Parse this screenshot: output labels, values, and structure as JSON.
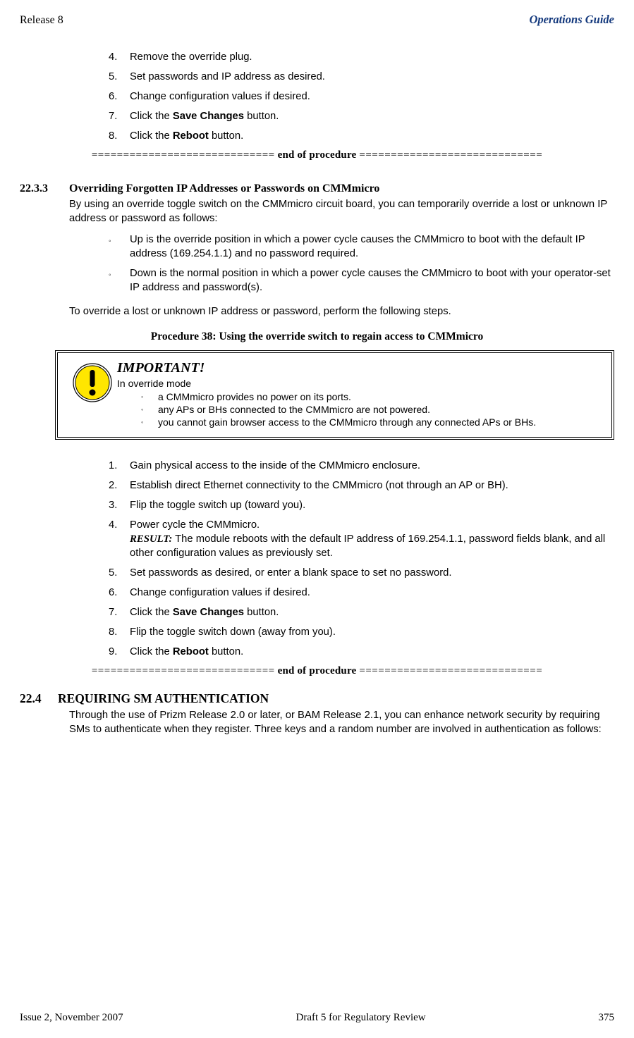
{
  "header": {
    "left": "Release 8",
    "right": "Operations Guide"
  },
  "proc1": {
    "items": [
      {
        "n": "4.",
        "pre": "Remove the override plug."
      },
      {
        "n": "5.",
        "pre": "Set passwords and IP address as desired."
      },
      {
        "n": "6.",
        "pre": "Change configuration values if desired."
      },
      {
        "n": "7.",
        "pre": "Click the ",
        "bold": "Save Changes",
        "post": " button."
      },
      {
        "n": "8.",
        "pre": "Click the ",
        "bold": "Reboot",
        "post": " button."
      }
    ]
  },
  "eop": {
    "sep": "=============================",
    "label": " end of procedure "
  },
  "section": {
    "num": "22.3.3",
    "title": "Overriding Forgotten IP Addresses or Passwords on CMMmicro",
    "intro": "By using an override toggle switch on the CMMmicro circuit board, you can temporarily override a lost or unknown IP address or password as follows:",
    "bullets": [
      "Up is the override position in which a power cycle causes the CMMmicro to boot with the default IP address (169.254.1.1) and no password required.",
      "Down is the normal position in which a power cycle causes the CMMmicro to boot with your operator-set IP address and password(s)."
    ],
    "lead": "To override a lost or unknown IP address or password, perform the following steps.",
    "proc_title": "Procedure 38: Using the override switch to regain access to CMMmicro"
  },
  "callout": {
    "title": "IMPORTANT!",
    "sub": "In override mode",
    "bullets": [
      "a CMMmicro provides no power on its ports.",
      "any APs or BHs connected to the CMMmicro are not powered.",
      "you cannot gain browser access to the CMMmicro through any connected APs or BHs."
    ]
  },
  "proc2": {
    "items": [
      {
        "n": "1.",
        "pre": "Gain physical access to the inside of the CMMmicro enclosure."
      },
      {
        "n": "2.",
        "pre": "Establish direct Ethernet connectivity to the CMMmicro (not through an AP or BH)."
      },
      {
        "n": "3.",
        "pre": "Flip the toggle switch up (toward you)."
      },
      {
        "n": "4.",
        "pre": "Power cycle the CMMmicro.",
        "result_label": "RESULT:",
        "result_text": " The module reboots with the default IP address of 169.254.1.1, password fields blank, and all other configuration values as previously set."
      },
      {
        "n": "5.",
        "pre": "Set passwords as desired, or enter a blank space to set no password."
      },
      {
        "n": "6.",
        "pre": "Change configuration values if desired."
      },
      {
        "n": "7.",
        "pre": "Click the ",
        "bold": "Save Changes",
        "post": " button."
      },
      {
        "n": "8.",
        "pre": "Flip the toggle switch down (away from you)."
      },
      {
        "n": "9.",
        "pre": "Click the ",
        "bold": "Reboot",
        "post": " button."
      }
    ]
  },
  "section2": {
    "num": "22.4",
    "title": "REQUIRING SM AUTHENTICATION",
    "body": "Through the use of Prizm Release 2.0 or later, or BAM Release 2.1, you can enhance network security by requiring SMs to authenticate when they register. Three keys and a random number are involved in authentication as follows:"
  },
  "footer": {
    "left": "Issue 2, November 2007",
    "center": "Draft 5 for Regulatory Review",
    "right": "375"
  }
}
